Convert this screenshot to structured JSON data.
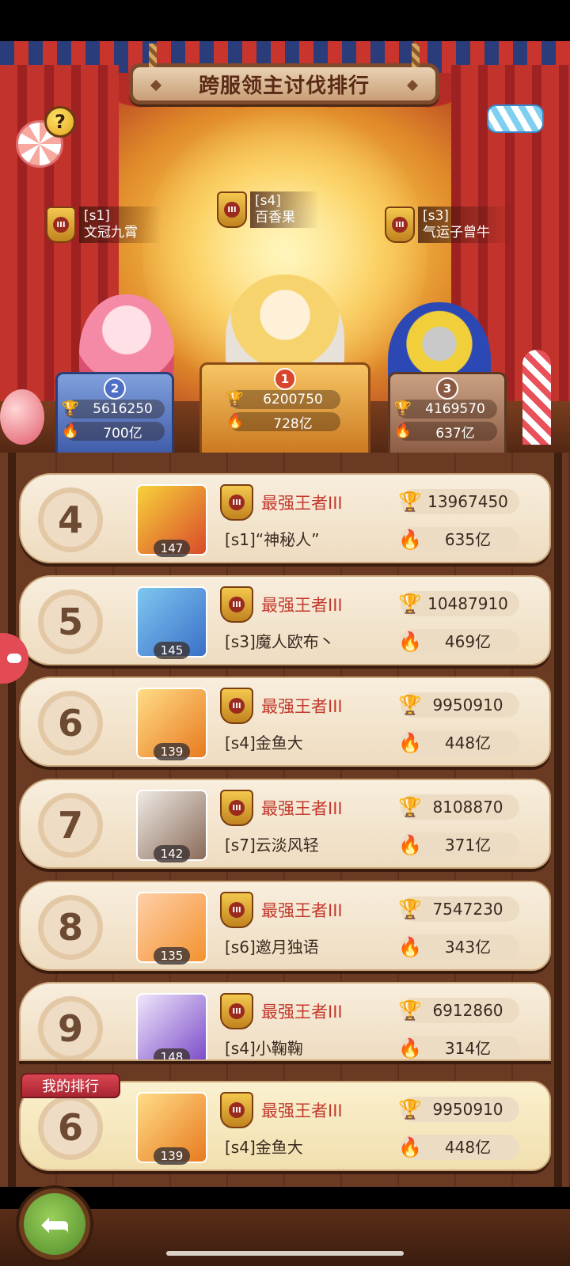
{
  "header": {
    "title": "跨服领主讨伐排行",
    "help_label": "?"
  },
  "top3": [
    {
      "rank": "2",
      "server": "[s1]",
      "name": "文冠九霄",
      "score": "5616250",
      "power": "700亿",
      "podium_color": "#5a78c8"
    },
    {
      "rank": "1",
      "server": "[s4]",
      "name": "百香果",
      "score": "6200750",
      "power": "728亿",
      "podium_color": "#e29a36"
    },
    {
      "rank": "3",
      "server": "[s3]",
      "name": "气运子曾牛",
      "score": "4169570",
      "power": "637亿",
      "podium_color": "#a8765a"
    }
  ],
  "rankings": [
    {
      "rank": "4",
      "level": "147",
      "tier": "最强王者III",
      "name": "[s1]“神秘人”",
      "score": "13967450",
      "power": "635亿"
    },
    {
      "rank": "5",
      "level": "145",
      "tier": "最强王者III",
      "name": "[s3]魔人欧布丶",
      "score": "10487910",
      "power": "469亿"
    },
    {
      "rank": "6",
      "level": "139",
      "tier": "最强王者III",
      "name": "[s4]金鱼大",
      "score": "9950910",
      "power": "448亿"
    },
    {
      "rank": "7",
      "level": "142",
      "tier": "最强王者III",
      "name": "[s7]云淡风轻",
      "score": "8108870",
      "power": "371亿"
    },
    {
      "rank": "8",
      "level": "135",
      "tier": "最强王者III",
      "name": "[s6]邀月独语",
      "score": "7547230",
      "power": "343亿"
    },
    {
      "rank": "9",
      "level": "148",
      "tier": "最强王者III",
      "name": "[s4]小鞠鞠",
      "score": "6912860",
      "power": "314亿"
    }
  ],
  "my_rank": {
    "tag": "我的排行",
    "rank": "6",
    "level": "139",
    "tier": "最强王者III",
    "name": "[s4]金鱼大",
    "score": "9950910",
    "power": "448亿"
  },
  "icons": {
    "trophy": "trophy-icon",
    "flame": "flame-icon",
    "back": "back-arrow-icon",
    "crown": "crown-badge-icon"
  },
  "colors": {
    "tier_text": "#c23a2e",
    "panel_bg": "#f4e6cf",
    "wood": "#5c301b"
  }
}
